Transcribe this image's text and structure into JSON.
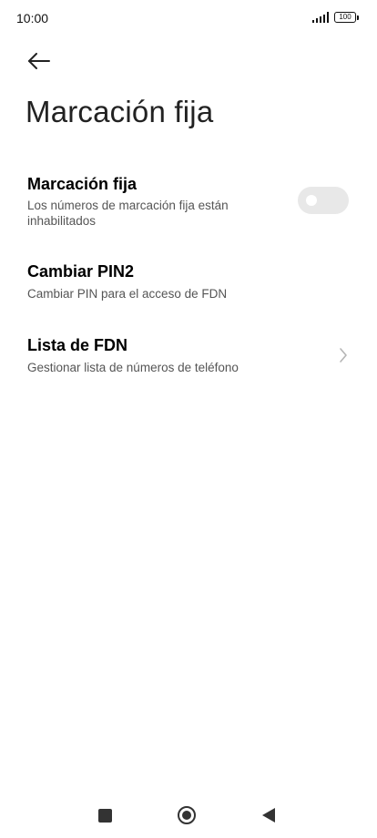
{
  "status_bar": {
    "time": "10:00",
    "battery": "100",
    "icons": [
      "signal-icon",
      "battery-icon"
    ]
  },
  "header": {
    "back_icon": "arrow-left-icon",
    "title": "Marcación fija"
  },
  "settings": [
    {
      "title": "Marcación fija",
      "subtitle": "Los números de marcación fija están inhabilitados",
      "control": "toggle",
      "toggle_on": false
    },
    {
      "title": "Cambiar PIN2",
      "subtitle": "Cambiar PIN para el acceso de FDN",
      "control": "none"
    },
    {
      "title": "Lista de FDN",
      "subtitle": "Gestionar lista de números de teléfono",
      "control": "chevron-right-icon"
    }
  ],
  "nav_bar": {
    "icons": [
      "recents-square-icon",
      "home-circle-icon",
      "back-triangle-icon"
    ]
  },
  "colors": {
    "background": "#ffffff",
    "title_text": "#000000",
    "subtitle_text": "#555555",
    "toggle_off_track": "#e8e8e8"
  }
}
